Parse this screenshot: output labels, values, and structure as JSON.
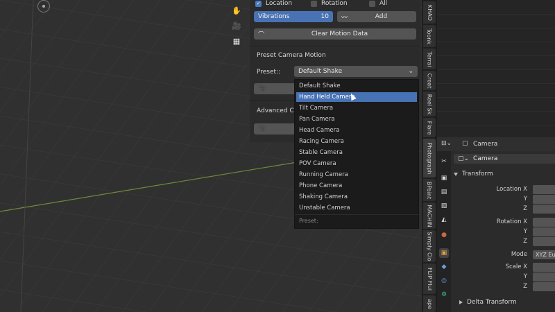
{
  "motion_toggles": {
    "location": {
      "label": "Location",
      "checked": true
    },
    "rotation": {
      "label": "Rotation",
      "checked": false
    },
    "all": {
      "label": "All",
      "checked": false
    }
  },
  "vibrations": {
    "label": "Vibrations",
    "value": "10"
  },
  "add_button": "Add",
  "clear_button": "Clear Motion Data",
  "preset_section": {
    "title": "Preset Camera Motion",
    "preset_label": "Preset::",
    "selected": "Default Shake"
  },
  "advanced_section": {
    "title": "Advanced Came"
  },
  "dropdown": {
    "items": [
      "Default Shake",
      "Hand Held Camera",
      "Tilt Camera",
      "Pan Camera",
      "Head Camera",
      "Racing Camera",
      "Stable Camera",
      "POV Camera",
      "Running Camera",
      "Phone Camera",
      "Shaking Camera",
      "Unstable Camera"
    ],
    "highlighted_index": 1,
    "footer": "Preset:"
  },
  "sidebar_tabs": [
    "KHAO",
    "Toonk",
    "Terrai",
    "Creat",
    "Reel Sk",
    "Flare",
    "Photograph",
    "BPaint",
    "MACHIN",
    "Simply Clo",
    "FLIP Flui",
    "ape"
  ],
  "properties": {
    "object_name_header": "Camera",
    "object_name": "Camera",
    "transform_title": "Transform",
    "location_x": "Location X",
    "y": "Y",
    "z": "Z",
    "rotation_x": "Rotation X",
    "mode_label": "Mode",
    "mode_value": "XYZ Eul",
    "scale_x": "Scale X",
    "delta_title": "Delta Transform"
  },
  "colors": {
    "accent": "#4772b3",
    "checkbox_on": "#4a7ac2"
  }
}
